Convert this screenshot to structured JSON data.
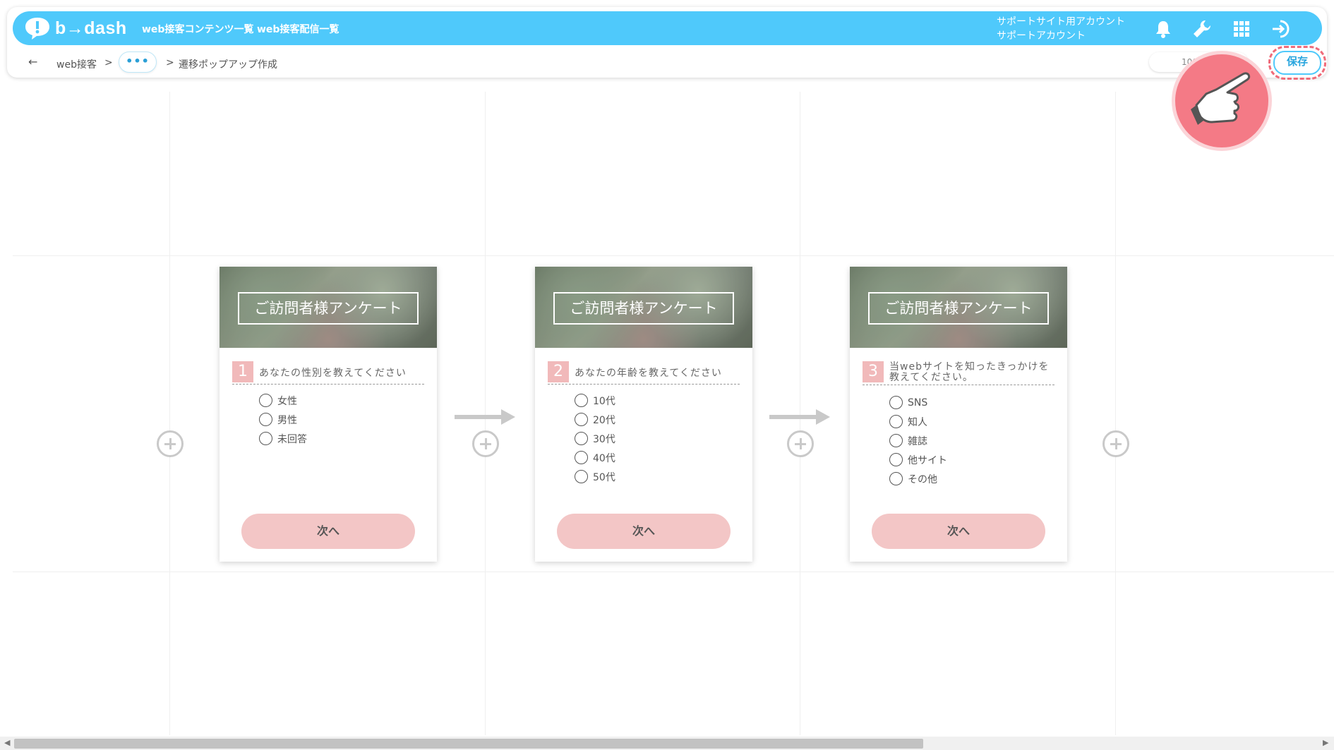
{
  "app": {
    "logo_text": "b→dash",
    "nav": [
      "web接客コンテンツ一覧",
      "web接客配信一覧"
    ],
    "account_line1": "サポートサイト用アカウント",
    "account_line2": "サポートアカウント",
    "icons": [
      "bell-icon",
      "wrench-icon",
      "grid-icon",
      "logout-icon"
    ]
  },
  "breadcrumb": {
    "back_icon": "←",
    "root": "web接客",
    "sep": ">",
    "more": "•••",
    "current": "遷移ポップアップ作成"
  },
  "toolbar": {
    "zoom": "100",
    "save_label": "保存",
    "highlight_color": "#ef6b7a"
  },
  "cards": [
    {
      "title": "ご訪問者様アンケート",
      "number": "1",
      "question": "あなたの性別を教えてください",
      "options": [
        "女性",
        "男性",
        "未回答"
      ],
      "next_label": "次へ"
    },
    {
      "title": "ご訪問者様アンケート",
      "number": "2",
      "question": "あなたの年齢を教えてください",
      "options": [
        "10代",
        "20代",
        "30代",
        "40代",
        "50代"
      ],
      "next_label": "次へ"
    },
    {
      "title": "ご訪問者様アンケート",
      "number": "3",
      "question": "当webサイトを知ったきっかけを教えてください。",
      "options": [
        "SNS",
        "知人",
        "雑誌",
        "他サイト",
        "その他"
      ],
      "next_label": "次へ"
    }
  ],
  "colors": {
    "brand": "#4fc9fb",
    "next_button": "#f3c6c6",
    "number_badge": "#f1b9ba"
  }
}
